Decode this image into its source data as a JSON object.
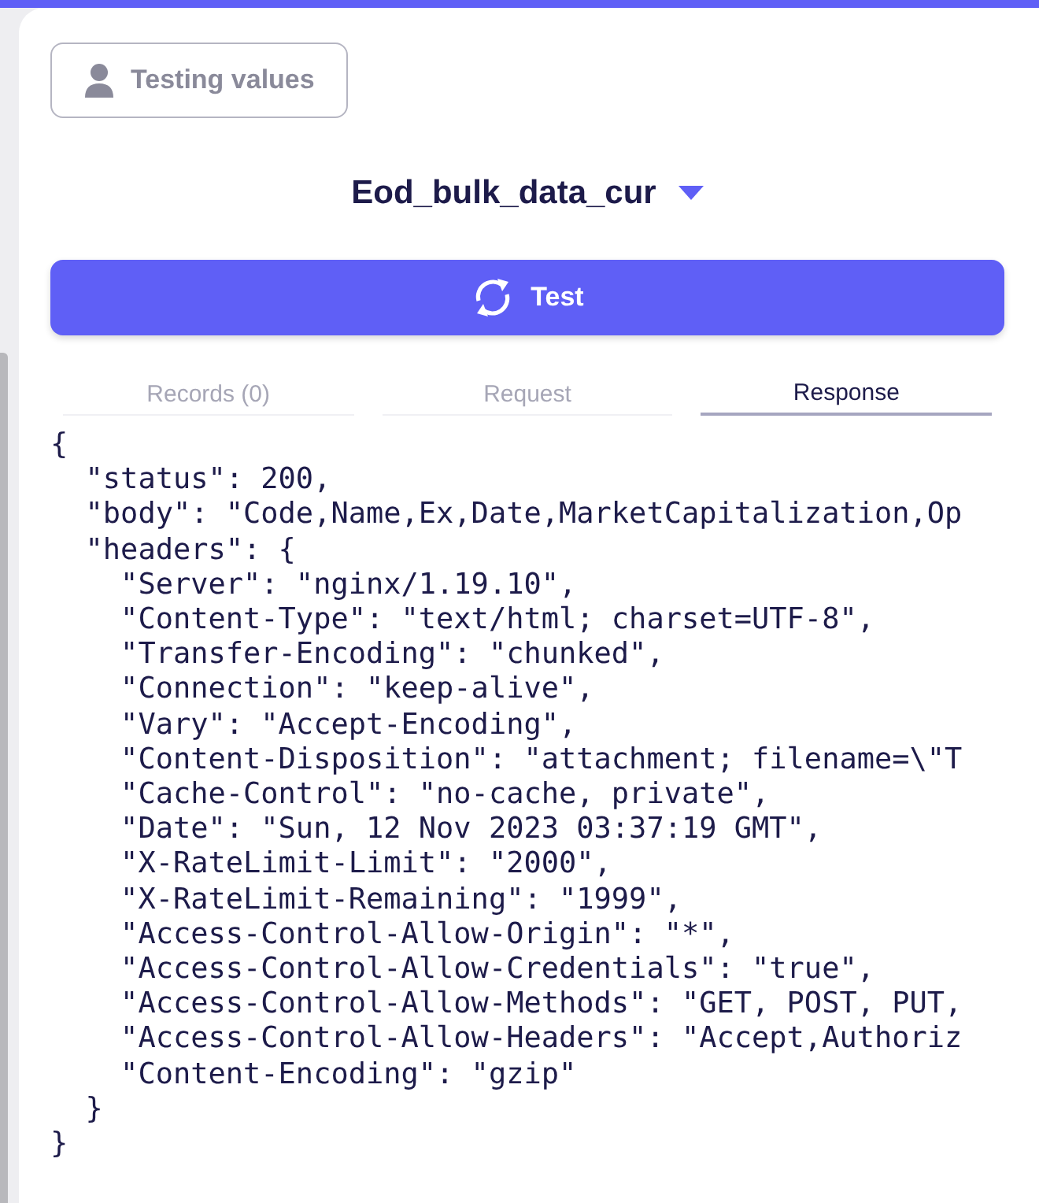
{
  "testing_button": {
    "label": "Testing values"
  },
  "dataset": {
    "title": "Eod_bulk_data_cur"
  },
  "test_button": {
    "label": "Test"
  },
  "tabs": [
    {
      "label": "Records (0)",
      "selected": false
    },
    {
      "label": "Request",
      "selected": false
    },
    {
      "label": "Response",
      "selected": true
    }
  ],
  "response_lines": [
    "{",
    "  \"status\": 200,",
    "  \"body\": \"Code,Name,Ex,Date,MarketCapitalization,Op",
    "  \"headers\": {",
    "    \"Server\": \"nginx/1.19.10\",",
    "    \"Content-Type\": \"text/html; charset=UTF-8\",",
    "    \"Transfer-Encoding\": \"chunked\",",
    "    \"Connection\": \"keep-alive\",",
    "    \"Vary\": \"Accept-Encoding\",",
    "    \"Content-Disposition\": \"attachment; filename=\\\"T",
    "    \"Cache-Control\": \"no-cache, private\",",
    "    \"Date\": \"Sun, 12 Nov 2023 03:37:19 GMT\",",
    "    \"X-RateLimit-Limit\": \"2000\",",
    "    \"X-RateLimit-Remaining\": \"1999\",",
    "    \"Access-Control-Allow-Origin\": \"*\",",
    "    \"Access-Control-Allow-Credentials\": \"true\",",
    "    \"Access-Control-Allow-Methods\": \"GET, POST, PUT,",
    "    \"Access-Control-Allow-Headers\": \"Accept,Authoriz",
    "    \"Content-Encoding\": \"gzip\"",
    "  }",
    "}"
  ]
}
